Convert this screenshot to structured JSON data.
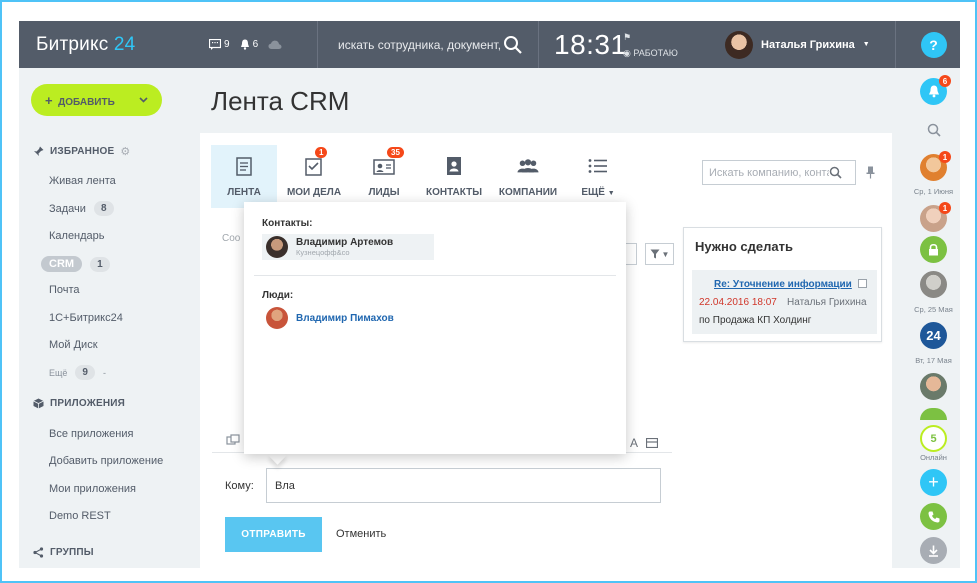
{
  "header": {
    "logo_text": "Битрикс",
    "logo_num": "24",
    "messages_count": "9",
    "notifications_count": "6",
    "search_placeholder": "искать сотрудника, документ, прочее...",
    "time": "18:31",
    "work_status": "РАБОТАЮ",
    "user_name": "Наталья Грихина",
    "help": "?"
  },
  "sidebar": {
    "add_button": "ДОБАВИТЬ",
    "favorites_title": "ИЗБРАННОЕ",
    "items": [
      {
        "label": "Живая лента",
        "count": ""
      },
      {
        "label": "Задачи",
        "count": "8"
      },
      {
        "label": "Календарь",
        "count": ""
      },
      {
        "label": "CRM",
        "count": "1"
      },
      {
        "label": "Почта",
        "count": ""
      },
      {
        "label": "1С+Битрикс24",
        "count": ""
      },
      {
        "label": "Мой Диск",
        "count": ""
      }
    ],
    "more_label": "Ещё",
    "more_count": "9",
    "apps_title": "ПРИЛОЖЕНИЯ",
    "apps": [
      "Все приложения",
      "Добавить приложение",
      "Мои приложения",
      "Demo REST"
    ],
    "groups_title": "ГРУППЫ"
  },
  "page": {
    "title": "Лента CRM"
  },
  "tabs": [
    {
      "label": "ЛЕНТА",
      "badge": ""
    },
    {
      "label": "МОИ ДЕЛА",
      "badge": "1"
    },
    {
      "label": "ЛИДЫ",
      "badge": "35"
    },
    {
      "label": "КОНТАКТЫ",
      "badge": ""
    },
    {
      "label": "КОМПАНИИ",
      "badge": ""
    },
    {
      "label": "ЕЩЁ",
      "badge": ""
    }
  ],
  "crm_search": {
    "placeholder": "Искать компанию, контакт..."
  },
  "message_label": "Соо",
  "todo": {
    "title": "Нужно сделать",
    "subject": "Re: Уточнение информации",
    "date": "22.04.2016 18:07",
    "responsible": "Наталья Грихина",
    "deal": "по Продажа КП Холдинг"
  },
  "compose": {
    "to_label": "Кому:",
    "to_value": "Вла",
    "send_label": "ОТПРАВИТЬ",
    "cancel_label": "Отменить"
  },
  "popup": {
    "contacts_title": "Контакты:",
    "contact_name": "Владимир Артемов",
    "contact_company": "Кузнецофф&со",
    "people_title": "Люди:",
    "person_name": "Владимир Пимахов"
  },
  "rail": {
    "notify_count": "6",
    "date1": "Ср, 1 Июня",
    "date2": "Ср, 25 Мая",
    "date3": "Вт, 17 Мая",
    "online_count": "5",
    "online_label": "Онлайн",
    "b24": "24",
    "badge1": "1",
    "badge2": "1"
  },
  "colors": {
    "topbar": "#535c69",
    "accent": "#2fc6f6",
    "add_button": "#bbed21",
    "send_button": "#59c6f1",
    "badge": "#f54819",
    "link": "#2067b0"
  }
}
